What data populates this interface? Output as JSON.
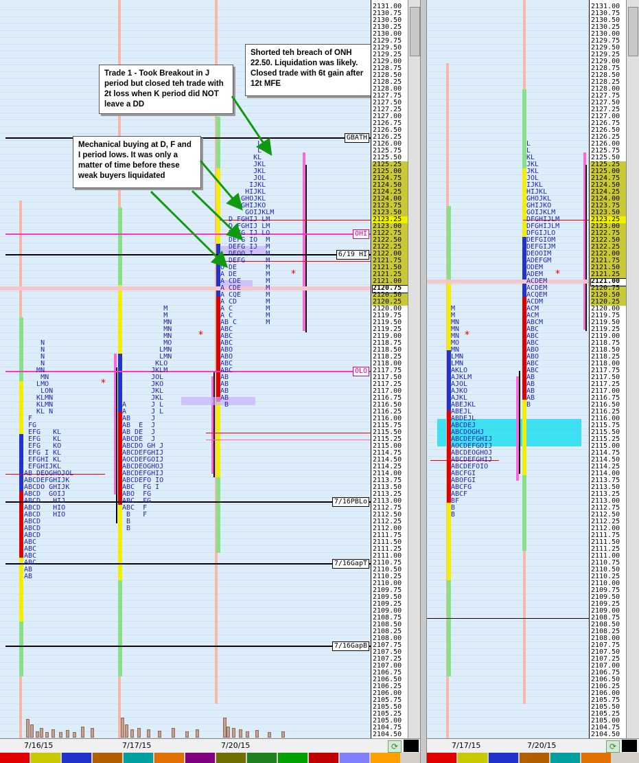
{
  "colors": {
    "background": "#ddeefa",
    "tpo_text": "#1f1fb4",
    "session_high_low_line": "#000000",
    "overnight_level_line": "#ff33cc",
    "value_area_highlight": "#c8c838",
    "poc_highlight": "#f0f000",
    "arrow": "#119911",
    "single_print_highlight": "#22ddee",
    "star_marker": "#ee0000"
  },
  "left_chart": {
    "price_scale": {
      "top": 2131.0,
      "step": 0.25,
      "count": 108,
      "labels_start": "2131.00",
      "highlight_range": [
        "2125.25",
        "2120.25"
      ],
      "poc_label": "2123.25",
      "current_label": "2120.75"
    },
    "levels": [
      {
        "label": "GBATH",
        "price": "2126.25"
      },
      {
        "label": "OHI",
        "price": "2122.75"
      },
      {
        "label": "6/19 HI",
        "price": "2122.00"
      },
      {
        "label": "OLO",
        "price": "2117.75"
      },
      {
        "label": "7/16PBLo",
        "price": "2113.00"
      },
      {
        "label": "7/16GapT",
        "price": "2110.75"
      },
      {
        "label": "7/16GapB",
        "price": "2107.75"
      }
    ],
    "dates": [
      "7/16/15",
      "7/17/15",
      "7/20/15"
    ],
    "annotations": [
      {
        "id": "note-1",
        "text": "Shorted teh breach of ONH 22.50. Liquidation was likely. Closed trade with 6t gain after 12t MFE"
      },
      {
        "id": "note-2",
        "text": "Trade 1 - Took Breakout in J period but closed teh trade with 2t loss when K period did NOT leave a DD"
      },
      {
        "id": "note-3",
        "text": "Mechanical buying at D, F and I period lows. It was only a matter of time before these weak buyers liquidated"
      }
    ],
    "profiles": [
      {
        "id": "profile-7-16",
        "rows": [
          {
            "price": 2118.75,
            "t": "    N"
          },
          {
            "price": 2118.5,
            "t": "    N"
          },
          {
            "price": 2118.25,
            "t": "    N"
          },
          {
            "price": 2118.0,
            "t": "    N"
          },
          {
            "price": 2117.75,
            "t": "   MN"
          },
          {
            "price": 2117.5,
            "t": "    MN"
          },
          {
            "price": 2117.25,
            "t": "   LMO"
          },
          {
            "price": 2117.0,
            "t": "    LON"
          },
          {
            "price": 2116.75,
            "t": "   KLMN"
          },
          {
            "price": 2116.5,
            "t": "   KLMN"
          },
          {
            "price": 2116.25,
            "t": "   KL N"
          },
          {
            "price": 2116.0,
            "t": " F"
          },
          {
            "price": 2115.75,
            "t": " FG"
          },
          {
            "price": 2115.5,
            "t": " EFG   KL"
          },
          {
            "price": 2115.25,
            "t": " EFG   KL"
          },
          {
            "price": 2115.0,
            "t": " EFG   KO"
          },
          {
            "price": 2114.75,
            "t": " EFG I KL"
          },
          {
            "price": 2114.5,
            "t": " EFGHI KL"
          },
          {
            "price": 2114.25,
            "t": " EFGHIJKL"
          },
          {
            "price": 2114.0,
            "t": "AB DEOGHOJOL"
          },
          {
            "price": 2113.75,
            "t": "ABCDEFGHIJK"
          },
          {
            "price": 2113.5,
            "t": "ABCDO GHIJK"
          },
          {
            "price": 2113.25,
            "t": "ABCD  GOIJ"
          },
          {
            "price": 2113.0,
            "t": "ABCD   HIJ"
          },
          {
            "price": 2112.75,
            "t": "ABCD   HIO"
          },
          {
            "price": 2112.5,
            "t": "ABCD   HIO"
          },
          {
            "price": 2112.25,
            "t": "ABCD"
          },
          {
            "price": 2112.0,
            "t": "ABCD"
          },
          {
            "price": 2111.75,
            "t": "ABCD"
          },
          {
            "price": 2111.5,
            "t": "ABC"
          },
          {
            "price": 2111.25,
            "t": "ABC"
          },
          {
            "price": 2111.0,
            "t": "ABC"
          },
          {
            "price": 2110.75,
            "t": "ABC"
          },
          {
            "price": 2110.5,
            "t": "AB"
          },
          {
            "price": 2110.25,
            "t": "AB"
          }
        ]
      },
      {
        "id": "profile-7-17",
        "rows": [
          {
            "price": 2120.0,
            "t": "          M"
          },
          {
            "price": 2119.75,
            "t": "          M"
          },
          {
            "price": 2119.5,
            "t": "          MN"
          },
          {
            "price": 2119.25,
            "t": "          MN"
          },
          {
            "price": 2119.0,
            "t": "          MN"
          },
          {
            "price": 2118.75,
            "t": "          MO"
          },
          {
            "price": 2118.5,
            "t": "         LMN"
          },
          {
            "price": 2118.25,
            "t": "         LMN"
          },
          {
            "price": 2118.0,
            "t": "        KLO"
          },
          {
            "price": 2117.75,
            "t": "       JKLM"
          },
          {
            "price": 2117.5,
            "t": "       JOL"
          },
          {
            "price": 2117.25,
            "t": "       JKO"
          },
          {
            "price": 2117.0,
            "t": "       JKL"
          },
          {
            "price": 2116.75,
            "t": "       JKL"
          },
          {
            "price": 2116.5,
            "t": "A      J L"
          },
          {
            "price": 2116.25,
            "t": "A      J L"
          },
          {
            "price": 2116.0,
            "t": "AB     J"
          },
          {
            "price": 2115.75,
            "t": "AB  E  J"
          },
          {
            "price": 2115.5,
            "t": "AB DE  J"
          },
          {
            "price": 2115.25,
            "t": "ABCDE  J"
          },
          {
            "price": 2115.0,
            "t": "ABCDO GH J"
          },
          {
            "price": 2114.75,
            "t": "ABCDEFGHIJ"
          },
          {
            "price": 2114.5,
            "t": "AOCDEFGOIJ"
          },
          {
            "price": 2114.25,
            "t": "ABCDEOGHOJ"
          },
          {
            "price": 2114.0,
            "t": "ABCDEFGHIJ"
          },
          {
            "price": 2113.75,
            "t": "ABCDEFO IO"
          },
          {
            "price": 2113.5,
            "t": "ABC  FG I"
          },
          {
            "price": 2113.25,
            "t": "ABO  FG"
          },
          {
            "price": 2113.0,
            "t": "ABC  FG"
          },
          {
            "price": 2112.75,
            "t": "ABC  F"
          },
          {
            "price": 2112.5,
            "t": " B   F"
          },
          {
            "price": 2112.25,
            "t": " B"
          },
          {
            "price": 2112.0,
            "t": " B"
          }
        ]
      },
      {
        "id": "profile-7-20",
        "rows": [
          {
            "price": 2126.0,
            "t": "         L"
          },
          {
            "price": 2125.75,
            "t": "         L"
          },
          {
            "price": 2125.5,
            "t": "        KL"
          },
          {
            "price": 2125.25,
            "t": "        JKL"
          },
          {
            "price": 2125.0,
            "t": "        JKL"
          },
          {
            "price": 2124.75,
            "t": "        JOL"
          },
          {
            "price": 2124.5,
            "t": "       IJKL"
          },
          {
            "price": 2124.25,
            "t": "      HIJKL"
          },
          {
            "price": 2124.0,
            "t": "     GHOJKL"
          },
          {
            "price": 2123.75,
            "t": "     GHIJKO"
          },
          {
            "price": 2123.5,
            "t": "      GOIJKLM"
          },
          {
            "price": 2123.25,
            "t": "  D FGHIJ LM"
          },
          {
            "price": 2123.0,
            "t": "  D FGHIJ LM"
          },
          {
            "price": 2122.75,
            "t": "  D FG IJ LO"
          },
          {
            "price": 2122.5,
            "t": "  DEFG IO  M"
          },
          {
            "price": 2122.25,
            "t": "  DEFG IJ  M"
          },
          {
            "price": 2122.0,
            "t": "  DEOO I   M"
          },
          {
            "price": 2121.75,
            "t": "A DEFG     M"
          },
          {
            "price": 2121.5,
            "t": "O DE       M"
          },
          {
            "price": 2121.25,
            "t": "A DE       M"
          },
          {
            "price": 2121.0,
            "t": "A CDE      M"
          },
          {
            "price": 2120.75,
            "t": "A CDE      M"
          },
          {
            "price": 2120.5,
            "t": "A CQE      M"
          },
          {
            "price": 2120.25,
            "t": "A CD       M"
          },
          {
            "price": 2120.0,
            "t": "A C        M"
          },
          {
            "price": 2119.75,
            "t": "A C        M"
          },
          {
            "price": 2119.5,
            "t": "AB C       M"
          },
          {
            "price": 2119.25,
            "t": "ABC"
          },
          {
            "price": 2119.0,
            "t": "ABC"
          },
          {
            "price": 2118.75,
            "t": "ABC"
          },
          {
            "price": 2118.5,
            "t": "ABO"
          },
          {
            "price": 2118.25,
            "t": "ABO"
          },
          {
            "price": 2118.0,
            "t": "ABC"
          },
          {
            "price": 2117.75,
            "t": "ABC"
          },
          {
            "price": 2117.5,
            "t": "AB"
          },
          {
            "price": 2117.25,
            "t": "AB"
          },
          {
            "price": 2117.0,
            "t": "AB"
          },
          {
            "price": 2116.75,
            "t": "AB"
          },
          {
            "price": 2116.5,
            "t": " B"
          }
        ]
      }
    ]
  },
  "right_chart": {
    "price_scale": {
      "top": 2131.0,
      "step": 0.25,
      "count": 108,
      "highlight_range": [
        "2125.25",
        "2120.25"
      ],
      "poc_label": "2123.25",
      "current_label": "2121.00"
    },
    "dates": [
      "7/17/15",
      "7/20/15"
    ],
    "profiles": [
      {
        "id": "profile-right-7-17",
        "rows": [
          {
            "price": 2120.0,
            "t": "M"
          },
          {
            "price": 2119.75,
            "t": "M"
          },
          {
            "price": 2119.5,
            "t": "MN"
          },
          {
            "price": 2119.25,
            "t": "MN"
          },
          {
            "price": 2119.0,
            "t": "MN"
          },
          {
            "price": 2118.75,
            "t": "MO"
          },
          {
            "price": 2118.5,
            "t": "MN"
          },
          {
            "price": 2118.25,
            "t": "LMN"
          },
          {
            "price": 2118.0,
            "t": "LMN"
          },
          {
            "price": 2117.75,
            "t": "AKLO"
          },
          {
            "price": 2117.5,
            "t": "AJKLM"
          },
          {
            "price": 2117.25,
            "t": "AJOL"
          },
          {
            "price": 2117.0,
            "t": "AJKO"
          },
          {
            "price": 2116.75,
            "t": "AJKL"
          },
          {
            "price": 2116.5,
            "t": "ABEJKL"
          },
          {
            "price": 2116.25,
            "t": "ABEJL"
          },
          {
            "price": 2116.0,
            "t": "ABDEJL"
          },
          {
            "price": 2115.75,
            "t": "ABCDEJ"
          },
          {
            "price": 2115.5,
            "t": "ABCDOGHJ"
          },
          {
            "price": 2115.25,
            "t": "ABCDEFGHIJ"
          },
          {
            "price": 2115.0,
            "t": "AOCDEFGOIJ"
          },
          {
            "price": 2114.75,
            "t": "ABCDEOGHOJ"
          },
          {
            "price": 2114.5,
            "t": "ABCDEFGHIJ"
          },
          {
            "price": 2114.25,
            "t": "ABCDEFOIO"
          },
          {
            "price": 2114.0,
            "t": "ABCFGI"
          },
          {
            "price": 2113.75,
            "t": "ABOFGI"
          },
          {
            "price": 2113.5,
            "t": "ABCFG"
          },
          {
            "price": 2113.25,
            "t": "ABCF"
          },
          {
            "price": 2113.0,
            "t": "BF"
          },
          {
            "price": 2112.75,
            "t": "B"
          },
          {
            "price": 2112.5,
            "t": "B"
          }
        ]
      },
      {
        "id": "profile-right-7-20",
        "rows": [
          {
            "price": 2126.0,
            "t": "L"
          },
          {
            "price": 2125.75,
            "t": "L"
          },
          {
            "price": 2125.5,
            "t": "KL"
          },
          {
            "price": 2125.25,
            "t": "JKL"
          },
          {
            "price": 2125.0,
            "t": "JKL"
          },
          {
            "price": 2124.75,
            "t": "JOL"
          },
          {
            "price": 2124.5,
            "t": "IJKL"
          },
          {
            "price": 2124.25,
            "t": "HIJKL"
          },
          {
            "price": 2124.0,
            "t": "GHOJKL"
          },
          {
            "price": 2123.75,
            "t": "GHIJKO"
          },
          {
            "price": 2123.5,
            "t": "GOIJKLM"
          },
          {
            "price": 2123.25,
            "t": "DFGHIJLM"
          },
          {
            "price": 2123.0,
            "t": "DFGHIJLM"
          },
          {
            "price": 2122.75,
            "t": "DFGIJLO"
          },
          {
            "price": 2122.5,
            "t": "DEFGIOM"
          },
          {
            "price": 2122.25,
            "t": "DEFGIJM"
          },
          {
            "price": 2122.0,
            "t": "DEOOIM"
          },
          {
            "price": 2121.75,
            "t": "ADEFGM"
          },
          {
            "price": 2121.5,
            "t": "ODEM"
          },
          {
            "price": 2121.25,
            "t": "ADEM"
          },
          {
            "price": 2121.0,
            "t": "ACDEM"
          },
          {
            "price": 2120.75,
            "t": "ACDEM"
          },
          {
            "price": 2120.5,
            "t": "ACQEM"
          },
          {
            "price": 2120.25,
            "t": "ACDM"
          },
          {
            "price": 2120.0,
            "t": "ACM"
          },
          {
            "price": 2119.75,
            "t": "ACM"
          },
          {
            "price": 2119.5,
            "t": "ABCM"
          },
          {
            "price": 2119.25,
            "t": "ABC"
          },
          {
            "price": 2119.0,
            "t": "ABC"
          },
          {
            "price": 2118.75,
            "t": "ABC"
          },
          {
            "price": 2118.5,
            "t": "ABO"
          },
          {
            "price": 2118.25,
            "t": "ABO"
          },
          {
            "price": 2118.0,
            "t": "ABC"
          },
          {
            "price": 2117.75,
            "t": "ABC"
          },
          {
            "price": 2117.5,
            "t": "AB"
          },
          {
            "price": 2117.25,
            "t": "AB"
          },
          {
            "price": 2117.0,
            "t": "AB"
          },
          {
            "price": 2116.75,
            "t": "AB"
          },
          {
            "price": 2116.5,
            "t": "B"
          }
        ]
      }
    ]
  }
}
